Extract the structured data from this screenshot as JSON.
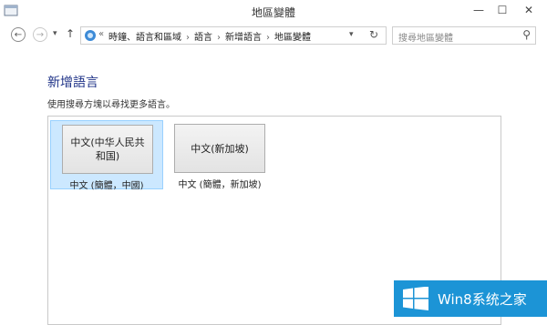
{
  "window": {
    "title": "地區變體",
    "minimize_glyph": "—",
    "maximize_glyph": "☐",
    "close_glyph": "✕"
  },
  "addressbar": {
    "back_glyph": "←",
    "forward_glyph": "→",
    "recent_glyph": "▾",
    "up_glyph": "↑",
    "overflow": "«",
    "breadcrumbs": [
      "時鐘、語言和區域",
      "語言",
      "新增語言",
      "地區變體"
    ],
    "separator": "›",
    "dropdown_glyph": "▾",
    "refresh_glyph": "↻",
    "search_placeholder": "搜尋地區變體",
    "search_glyph": "⚲"
  },
  "content": {
    "heading": "新增語言",
    "description": "使用搜尋方塊以尋找更多語言。",
    "variants": [
      {
        "label": "中文(中华人民共和国)",
        "caption": "中文 (簡體，中國)",
        "selected": true
      },
      {
        "label": "中文(新加坡)",
        "caption": "中文 (簡體，新加坡)",
        "selected": false
      }
    ]
  },
  "watermark": {
    "text": "Win8系统之家",
    "color": "#1c94d6"
  },
  "colors": {
    "heading": "#1e3287",
    "selection": "#cce8ff",
    "selection_border": "#99d1ff"
  }
}
